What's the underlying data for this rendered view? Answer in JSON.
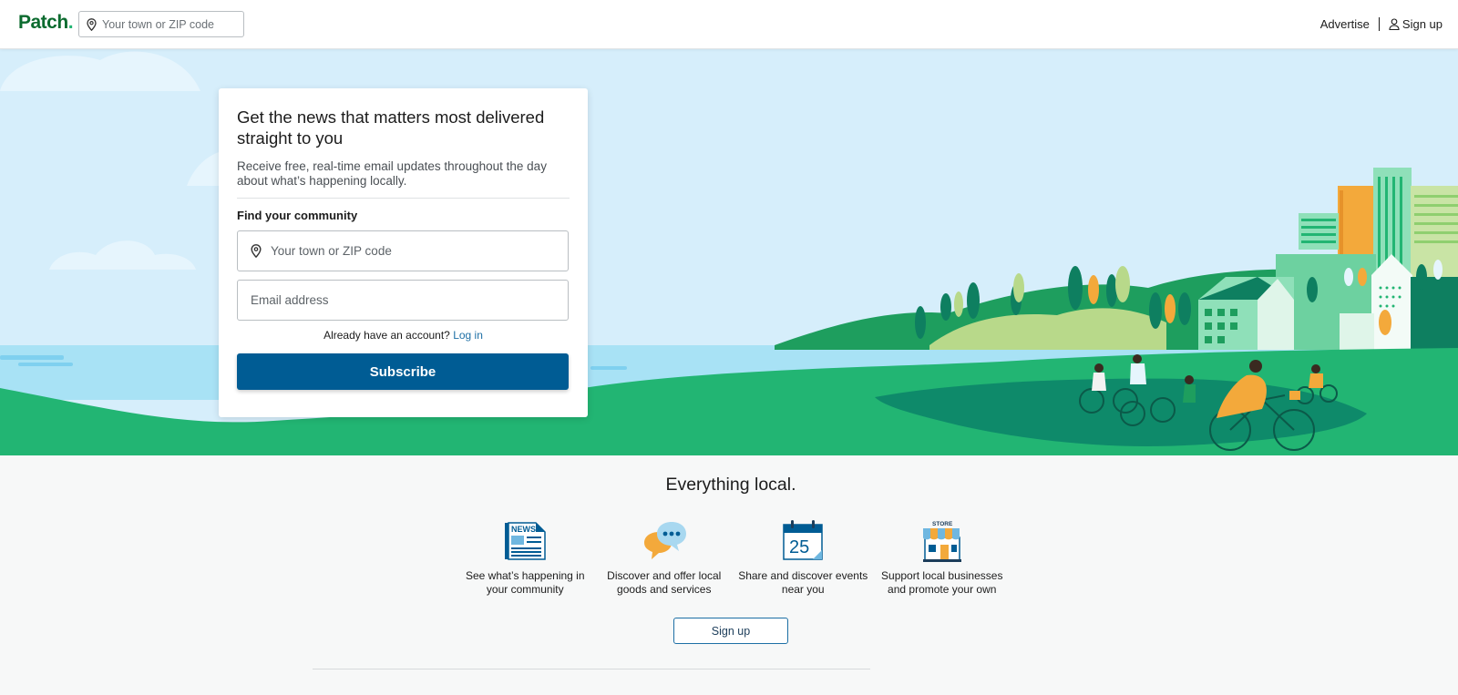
{
  "header": {
    "logo": "Patch",
    "search_placeholder": "Your town or ZIP code",
    "advertise": "Advertise",
    "signup": "Sign up"
  },
  "hero_card": {
    "title": "Get the news that matters most delivered straight to you",
    "description": "Receive free, real-time email updates throughout the day about what’s happening locally.",
    "find_label": "Find your community",
    "town_placeholder": "Your town or ZIP code",
    "email_placeholder": "Email address",
    "account_prompt": "Already have an account?",
    "login_link": "Log in",
    "subscribe_label": "Subscribe"
  },
  "local": {
    "title": "Everything local.",
    "features": [
      {
        "icon": "news-icon",
        "icon_text": "NEWS",
        "caption": "See what’s happening in your community"
      },
      {
        "icon": "chat-bubbles-icon",
        "caption": "Discover and offer local goods and services"
      },
      {
        "icon": "calendar-icon",
        "icon_text": "25",
        "caption": "Share and discover events near you"
      },
      {
        "icon": "store-icon",
        "icon_text": "STORE",
        "caption": "Support local businesses and promote your own"
      }
    ],
    "signup_label": "Sign up"
  },
  "colors": {
    "brand_green": "#0c6b2f",
    "primary_blue": "#005c94",
    "link_blue": "#1d6fa5",
    "sky": "#d6eefb",
    "grass": "#22b573"
  }
}
